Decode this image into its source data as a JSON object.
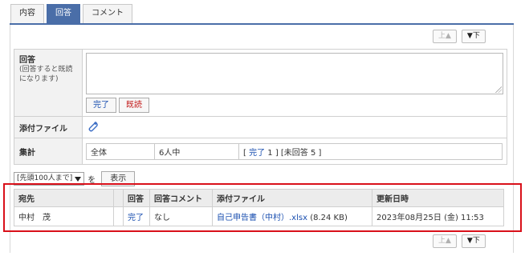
{
  "tabs": [
    {
      "label": "内容"
    },
    {
      "label": "回答"
    },
    {
      "label": "コメント"
    }
  ],
  "nav": {
    "up_label": "上▲",
    "down_label": "▼下"
  },
  "form": {
    "answer_label": "回答",
    "answer_note": "(回答すると既読になります)",
    "answer_value": "",
    "done_button": "完了",
    "read_button": "既読",
    "attachment_label": "添付ファイル",
    "summary_label": "集計",
    "summary": {
      "scope": "全体",
      "count": "6人中",
      "bracket_open": "[ ",
      "done_link": "完了",
      "done_count": " 1 ] [未回答 5 ]"
    }
  },
  "filter": {
    "select_value": "[先頭100人まで]",
    "wo_label": "を",
    "show_button": "表示"
  },
  "list": {
    "headers": [
      "宛先",
      "",
      "回答",
      "回答コメント",
      "添付ファイル",
      "更新日時"
    ],
    "rows": [
      {
        "recipient": "中村　茂",
        "answer": "完了",
        "comment": "なし",
        "file": "自己申告書（中村）.xlsx",
        "size": " (8.24 KB)",
        "updated": "2023年08月25日 (金) 11:53"
      }
    ]
  },
  "colors": {
    "tab_active": "#4a6ea8",
    "link": "#1a4fb0",
    "highlight": "#d9101a",
    "read_button": "#c21818"
  }
}
